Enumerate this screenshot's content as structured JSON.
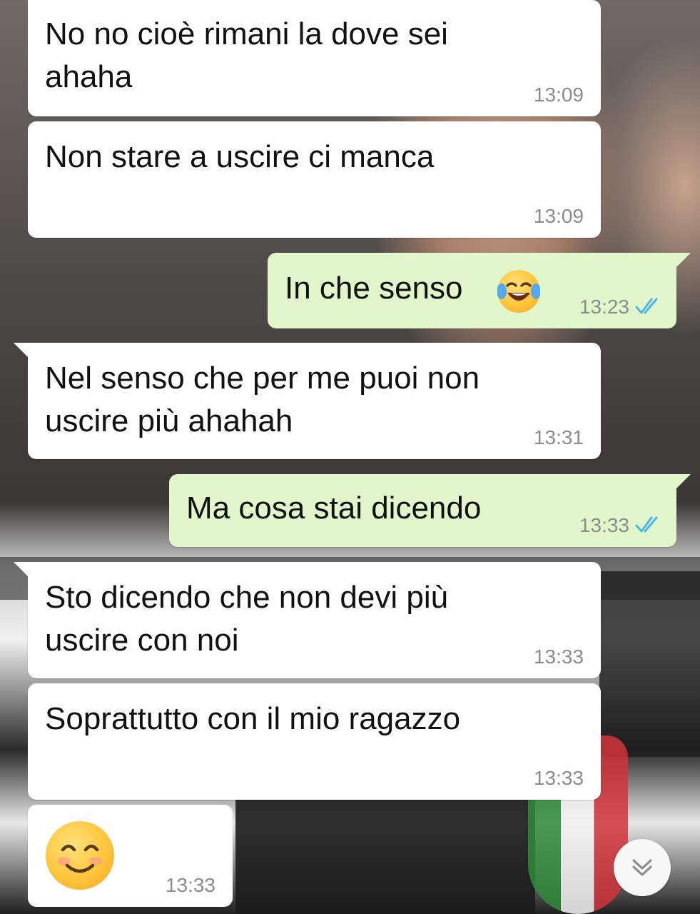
{
  "chat": {
    "messages": [
      {
        "direction": "in",
        "text": "No no cioè rimani la dove sei\nahaha",
        "time": "13:09"
      },
      {
        "direction": "in",
        "text": "Non stare a uscire ci manca",
        "time": "13:09"
      },
      {
        "direction": "out",
        "text": "In che senso",
        "emoji": "tears-of-joy-emoji",
        "time": "13:23",
        "status": "read"
      },
      {
        "direction": "in",
        "text": "Nel senso che per me puoi non\nuscire più ahahah",
        "time": "13:31"
      },
      {
        "direction": "out",
        "text": "Ma cosa stai dicendo",
        "time": "13:33",
        "status": "read"
      },
      {
        "direction": "in",
        "text": "Sto dicendo che non devi più\nuscire con noi",
        "time": "13:33"
      },
      {
        "direction": "in",
        "text": "Soprattutto con il mio ragazzo",
        "time": "13:33"
      },
      {
        "direction": "in",
        "text": "",
        "emoji": "smiling-face-emoji",
        "time": "13:33"
      }
    ],
    "scroll_button_icon": "double-chevron-down-icon"
  },
  "colors": {
    "incoming_bubble": "#ffffff",
    "outgoing_bubble": "#e1f7cb",
    "read_ticks": "#4fb6ec",
    "timestamp": "#8c8c8c"
  }
}
